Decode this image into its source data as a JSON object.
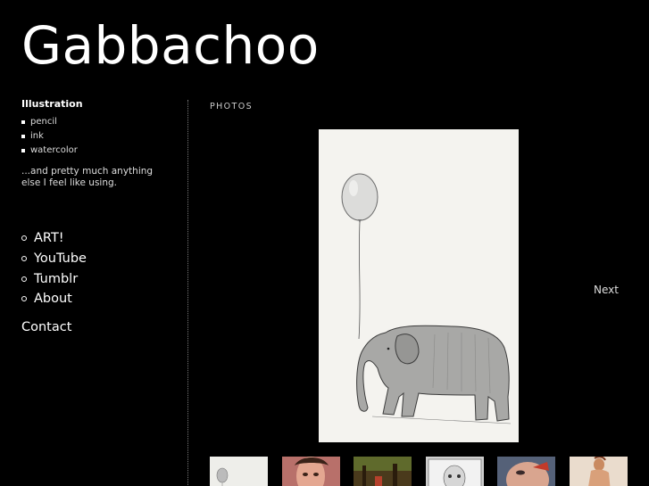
{
  "site": {
    "title": "Gabbachoo"
  },
  "sidebar": {
    "heading": "Illustration",
    "media": [
      "pencil",
      "ink",
      "watercolor"
    ],
    "description": "...and pretty much anything else I feel like using."
  },
  "nav": {
    "items": [
      {
        "label": "ART!"
      },
      {
        "label": "YouTube"
      },
      {
        "label": "Tumblr"
      },
      {
        "label": "About"
      }
    ],
    "contact": "Contact"
  },
  "gallery": {
    "label": "PHOTOS",
    "next_label": "Next",
    "main_photo": {
      "subject": "elephant-with-balloon-pencil-drawing"
    },
    "thumbnails": [
      {
        "subject": "elephant-balloon-drawing",
        "bg": "#eeeeea"
      },
      {
        "subject": "girl-portrait-painting",
        "bg": "#b8706a"
      },
      {
        "subject": "forest-scene-painting",
        "bg": "#4a3a1c"
      },
      {
        "subject": "framed-child-portrait",
        "bg": "#cfcfcf"
      },
      {
        "subject": "painted-face-closeup",
        "bg": "#8a6a62"
      },
      {
        "subject": "figure-painting",
        "bg": "#eadccd"
      }
    ]
  }
}
